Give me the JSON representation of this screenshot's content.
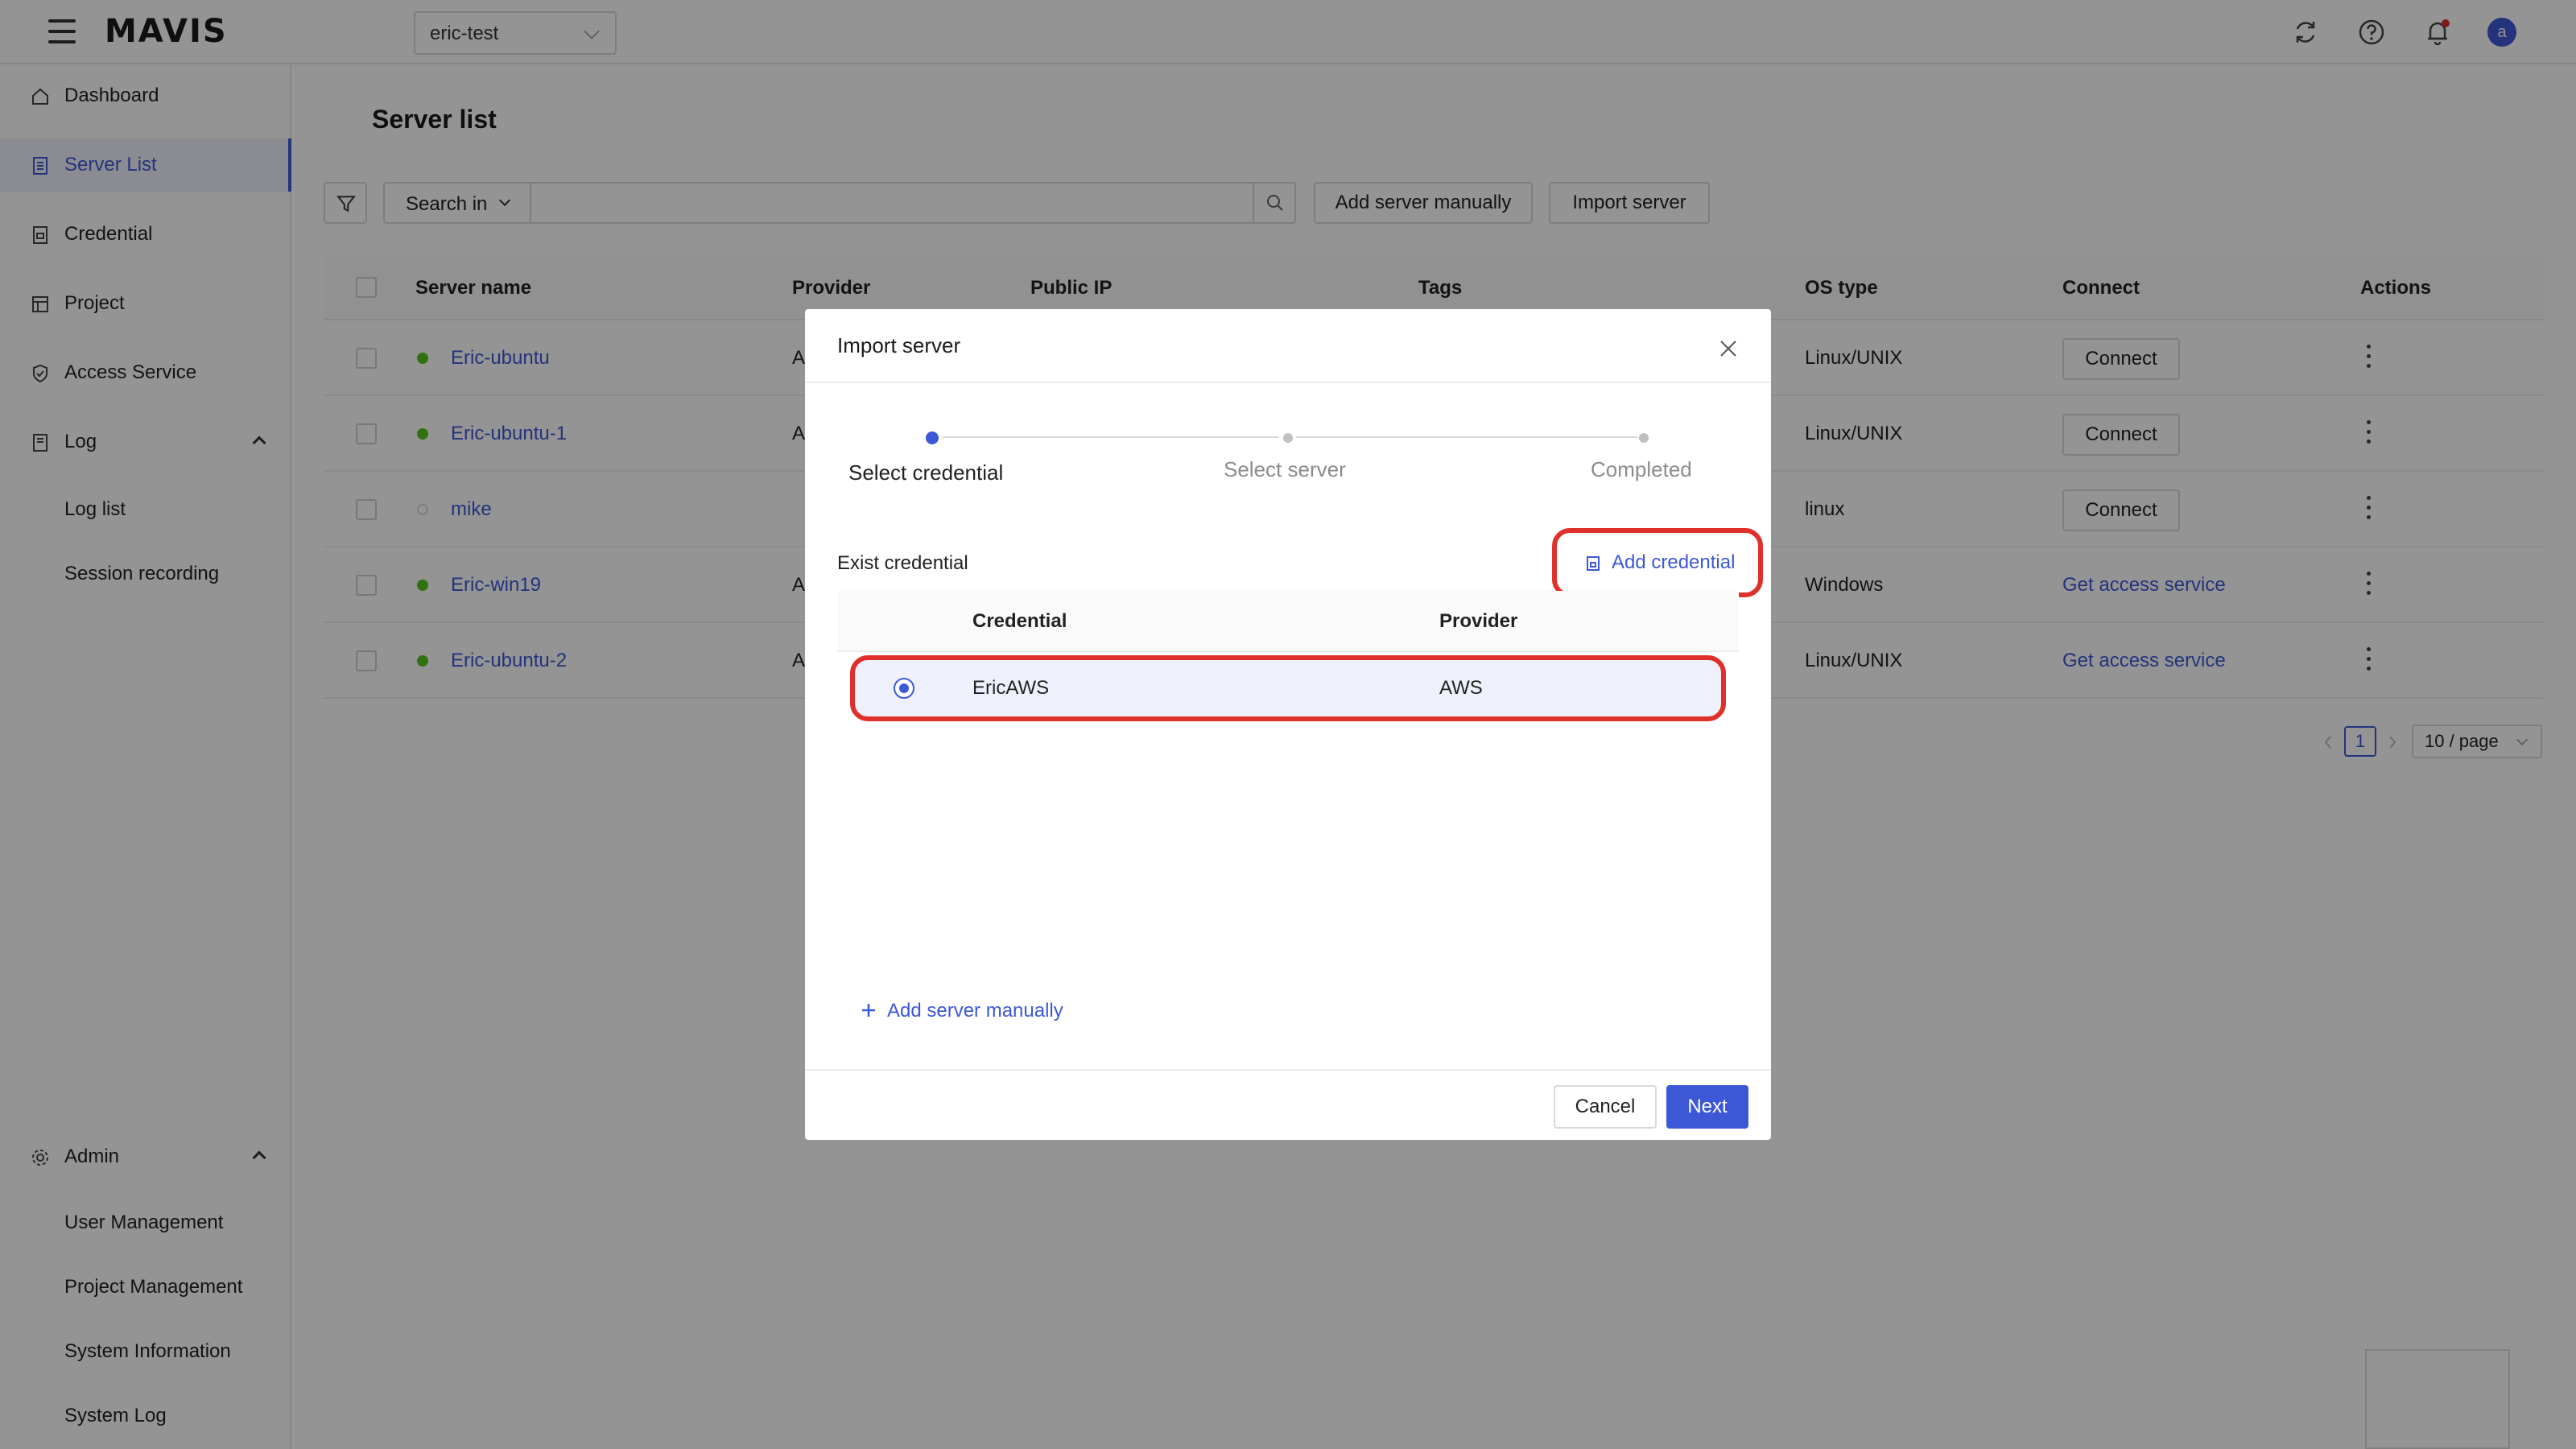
{
  "app": {
    "logo": "MAVIS",
    "project": "eric-test",
    "avatar_initial": "a"
  },
  "sidebar": {
    "items": [
      {
        "label": "Dashboard",
        "icon": "home-icon"
      },
      {
        "label": "Server List",
        "icon": "server-list-icon",
        "active": true
      },
      {
        "label": "Credential",
        "icon": "credential-icon"
      },
      {
        "label": "Project",
        "icon": "project-icon"
      },
      {
        "label": "Access Service",
        "icon": "shield-icon"
      },
      {
        "label": "Log",
        "icon": "log-icon",
        "expanded": true
      }
    ],
    "log_children": [
      "Log list",
      "Session recording"
    ],
    "admin": {
      "label": "Admin",
      "icon": "gear-icon"
    },
    "admin_children": [
      "User Management",
      "Project Management",
      "System Information",
      "System Log"
    ]
  },
  "main": {
    "title": "Server list",
    "search_in": "Search in",
    "search_placeholder": "",
    "add_server_manually": "Add server manually",
    "import_server": "Import server",
    "columns": [
      "Server name",
      "Provider",
      "Public IP",
      "Tags",
      "OS type",
      "Connect",
      "Actions"
    ],
    "rows": [
      {
        "name": "Eric-ubuntu",
        "provider": "A",
        "status": "online",
        "os": "Linux/UNIX",
        "connect": "Connect",
        "connect_type": "button"
      },
      {
        "name": "Eric-ubuntu-1",
        "provider": "A",
        "status": "online",
        "os": "Linux/UNIX",
        "connect": "Connect",
        "connect_type": "button"
      },
      {
        "name": "mike",
        "provider": "",
        "status": "offline",
        "os": "linux",
        "connect": "Connect",
        "connect_type": "button"
      },
      {
        "name": "Eric-win19",
        "provider": "A",
        "status": "online",
        "os": "Windows",
        "connect": "Get access service",
        "connect_type": "link"
      },
      {
        "name": "Eric-ubuntu-2",
        "provider": "A",
        "status": "online",
        "os": "Linux/UNIX",
        "connect": "Get access service",
        "connect_type": "link"
      }
    ],
    "pagination": {
      "current_page": "1",
      "page_size": "10 / page"
    }
  },
  "modal": {
    "title": "Import server",
    "steps": [
      "Select credential",
      "Select server",
      "Completed"
    ],
    "current_step": 0,
    "section_label": "Exist credential",
    "add_credential": "Add credential",
    "columns": [
      "Credential",
      "Provider"
    ],
    "credentials": [
      {
        "name": "EricAWS",
        "provider": "AWS",
        "selected": true
      }
    ],
    "add_server_manually": "Add server manually",
    "cancel": "Cancel",
    "next": "Next"
  },
  "colors": {
    "accent": "#3d58d6",
    "status_online": "#52c41a",
    "status_offline": "#d9d9d9",
    "highlight": "#e0302a",
    "notification": "#e0302a"
  }
}
